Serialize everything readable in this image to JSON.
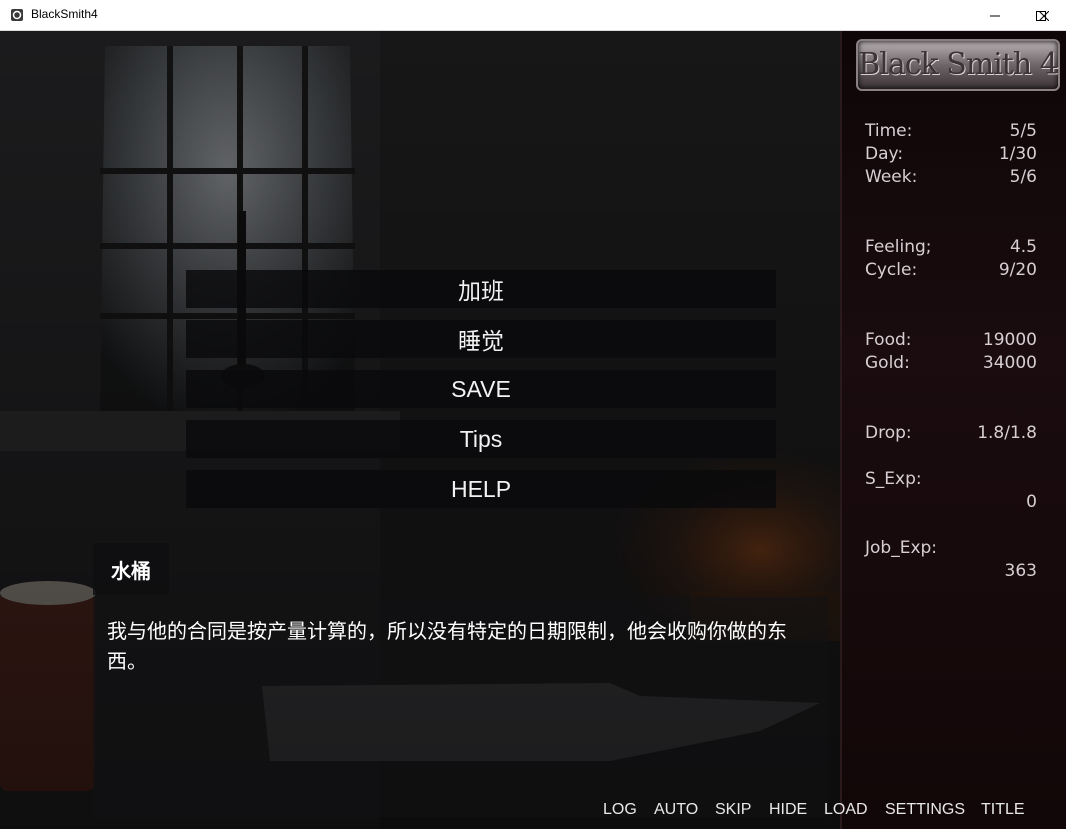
{
  "window": {
    "title": "BlackSmith4"
  },
  "logo": {
    "text": "Black Smith 4"
  },
  "stats": [
    {
      "label": "Time:",
      "value": "5/5"
    },
    {
      "label": "Day:",
      "value": "1/30"
    },
    {
      "label": "Week:",
      "value": "5/6"
    },
    {
      "label": "Feeling;",
      "value": "4.5"
    },
    {
      "label": "Cycle:",
      "value": "9/20"
    },
    {
      "label": "Food:",
      "value": "19000"
    },
    {
      "label": "Gold:",
      "value": "34000"
    },
    {
      "label": "Drop:",
      "value": "1.8/1.8"
    },
    {
      "label": "S_Exp:",
      "value": "0"
    },
    {
      "label": "Job_Exp:",
      "value": "363"
    }
  ],
  "choices": [
    "加班",
    "睡觉",
    "SAVE",
    "Tips",
    "HELP"
  ],
  "dialogue": {
    "speaker": "水桶",
    "text": "我与他的合同是按产量计算的，所以没有特定的日期限制，他会收购你做的东西。"
  },
  "quick_menu": [
    "LOG",
    "AUTO",
    "SKIP",
    "HIDE",
    "LOAD",
    "SETTINGS",
    "TITLE"
  ],
  "colors": {
    "panel": "#1a0c0f",
    "text": "#d7cfd3",
    "choice_bg": "#0a0a0c"
  }
}
